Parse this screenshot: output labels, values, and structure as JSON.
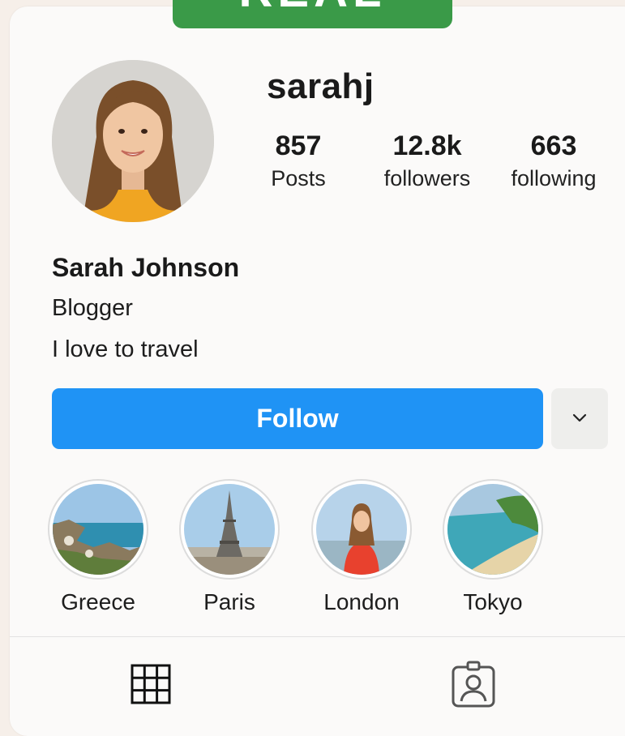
{
  "banner": {
    "text": "REAL"
  },
  "profile": {
    "username": "sarahj",
    "full_name": "Sarah Johnson",
    "bio": [
      "Blogger",
      "I love to travel"
    ]
  },
  "stats": [
    {
      "value": "857",
      "label": "Posts"
    },
    {
      "value": "12.8k",
      "label": "followers"
    },
    {
      "value": "663",
      "label": "following"
    }
  ],
  "actions": {
    "follow_label": "Follow",
    "dropdown_icon": "chevron-down-icon"
  },
  "highlights": [
    {
      "label": "Greece"
    },
    {
      "label": "Paris"
    },
    {
      "label": "London"
    },
    {
      "label": "Tokyo"
    }
  ],
  "tabs": [
    {
      "icon": "grid-icon"
    },
    {
      "icon": "tagged-person-icon"
    }
  ],
  "colors": {
    "follow_button": "#1f93f5",
    "banner": "#3a9a48"
  }
}
